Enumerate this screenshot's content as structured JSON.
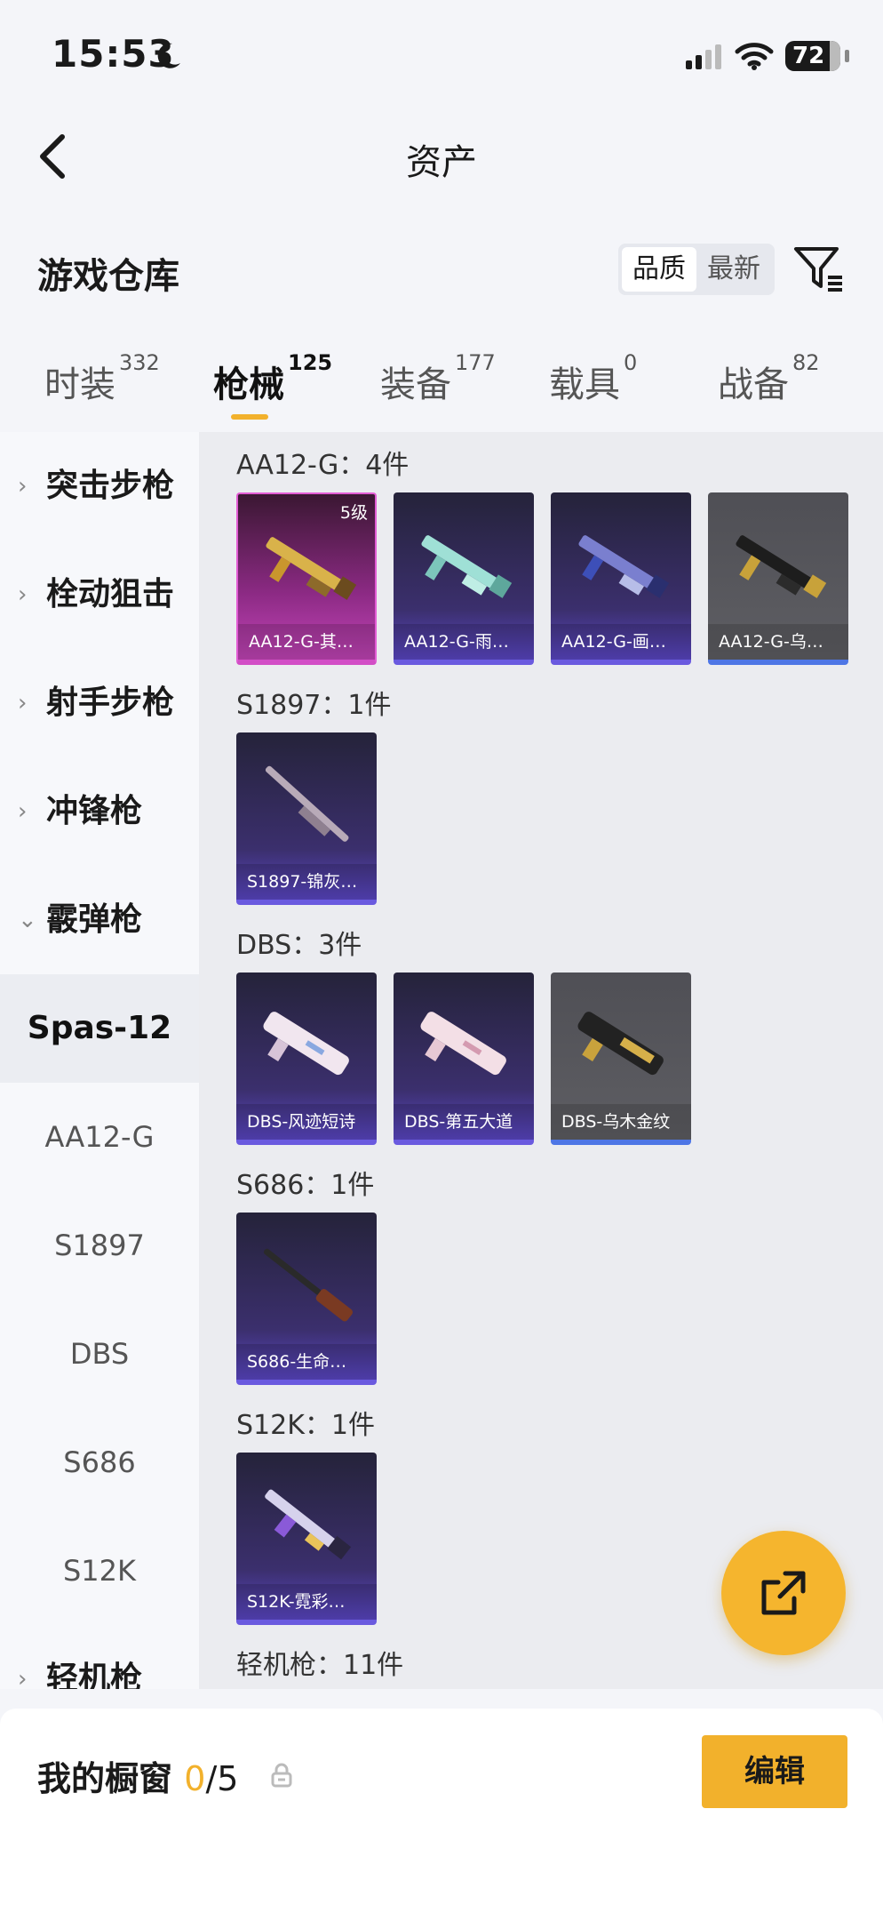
{
  "status_bar": {
    "time": "15:53",
    "battery": "72"
  },
  "nav": {
    "title": "资产"
  },
  "header": {
    "section_title": "游戏仓库",
    "sort_options": [
      "品质",
      "最新"
    ],
    "sort_selected": "品质"
  },
  "tabs": [
    {
      "label": "时装",
      "count": "332"
    },
    {
      "label": "枪械",
      "count": "125",
      "active": true
    },
    {
      "label": "装备",
      "count": "177"
    },
    {
      "label": "载具",
      "count": "0"
    },
    {
      "label": "战备",
      "count": "82"
    }
  ],
  "sidebar": {
    "categories": [
      {
        "label": "突击步枪",
        "chevron": "›"
      },
      {
        "label": "栓动狙击",
        "chevron": "›"
      },
      {
        "label": "射手步枪",
        "chevron": "›"
      },
      {
        "label": "冲锋枪",
        "chevron": "›"
      },
      {
        "label": "霰弹枪",
        "chevron": "⌄"
      }
    ],
    "selected_sub": "Spas-12",
    "subs": [
      "AA12-G",
      "S1897",
      "DBS",
      "S686",
      "S12K"
    ],
    "next_category": {
      "label": "轻机枪",
      "chevron": "›"
    }
  },
  "content": {
    "groups": [
      {
        "title": "AA12-G：4件",
        "items": [
          {
            "label": "AA12-G-其…",
            "level": "5级",
            "rarity": "pink"
          },
          {
            "label": "AA12-G-雨…",
            "rarity": "purple"
          },
          {
            "label": "AA12-G-画…",
            "rarity": "purple"
          },
          {
            "label": "AA12-G-乌…",
            "rarity": "gray"
          }
        ]
      },
      {
        "title": "S1897：1件",
        "items": [
          {
            "label": "S1897-锦灰…",
            "rarity": "purple"
          }
        ]
      },
      {
        "title": "DBS：3件",
        "items": [
          {
            "label": "DBS-风迹短诗",
            "rarity": "purple"
          },
          {
            "label": "DBS-第五大道",
            "rarity": "purple"
          },
          {
            "label": "DBS-乌木金纹",
            "rarity": "gray"
          }
        ]
      },
      {
        "title": "S686：1件",
        "items": [
          {
            "label": "S686-生命…",
            "rarity": "purple"
          }
        ]
      },
      {
        "title": "S12K：1件",
        "items": [
          {
            "label": "S12K-霓彩…",
            "rarity": "purple"
          }
        ]
      },
      {
        "title": "轻机枪：11件",
        "items": []
      }
    ]
  },
  "bottom": {
    "showcase_title": "我的橱窗",
    "count_current": "0",
    "count_total": "/5",
    "edit_label": "编辑"
  },
  "colors": {
    "accent": "#f2b12c",
    "purple_card": "#3b2f6d",
    "pink_card": "#c345b8",
    "gray_card": "#5e5e63"
  }
}
